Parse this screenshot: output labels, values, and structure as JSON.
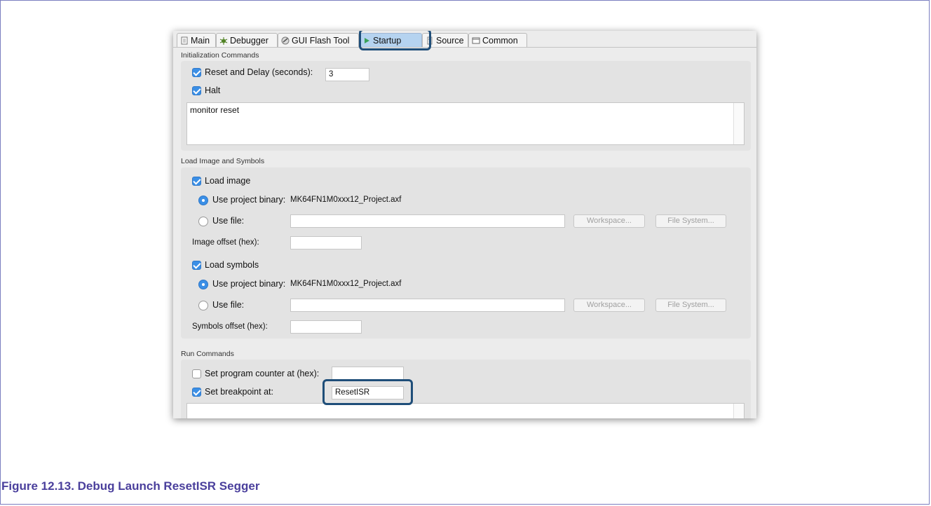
{
  "tabs": [
    {
      "label": "Main",
      "icon": "document-icon"
    },
    {
      "label": "Debugger",
      "icon": "bug-icon"
    },
    {
      "label": "GUI Flash Tool",
      "icon": "flash-icon"
    },
    {
      "label": "Startup",
      "icon": "play-icon"
    },
    {
      "label": "Source",
      "icon": "source-icon"
    },
    {
      "label": "Common",
      "icon": "common-icon"
    }
  ],
  "init": {
    "section_label": "Initialization Commands",
    "reset_delay_label": "Reset and Delay (seconds):",
    "reset_delay_value": "3",
    "halt_label": "Halt",
    "commands_text": "monitor reset"
  },
  "load": {
    "section_label": "Load Image and Symbols",
    "load_image_label": "Load image",
    "image_use_project_label": "Use project binary:",
    "image_project_binary": "MK64FN1M0xxx12_Project.axf",
    "image_use_file_label": "Use file:",
    "image_file_value": "",
    "workspace_label": "Workspace...",
    "file_system_label": "File System...",
    "image_offset_label": "Image offset (hex):",
    "image_offset_value": "",
    "load_symbols_label": "Load symbols",
    "symbols_use_project_label": "Use project binary:",
    "symbols_project_binary": "MK64FN1M0xxx12_Project.axf",
    "symbols_use_file_label": "Use file:",
    "symbols_file_value": "",
    "symbols_workspace_label": "Workspace...",
    "symbols_file_system_label": "File System...",
    "symbols_offset_label": "Symbols offset (hex):",
    "symbols_offset_value": ""
  },
  "run": {
    "section_label": "Run Commands",
    "set_pc_label": "Set program counter at (hex):",
    "set_pc_value": "",
    "set_bp_label": "Set breakpoint at:",
    "set_bp_value": "ResetISR"
  },
  "caption": "Figure 12.13. Debug Launch ResetISR Segger",
  "colors": {
    "highlight_border": "#1f4e79",
    "caption": "#4a3f9c",
    "check_blue": "#3b8fe6",
    "active_tab": "#b5d3f0"
  }
}
